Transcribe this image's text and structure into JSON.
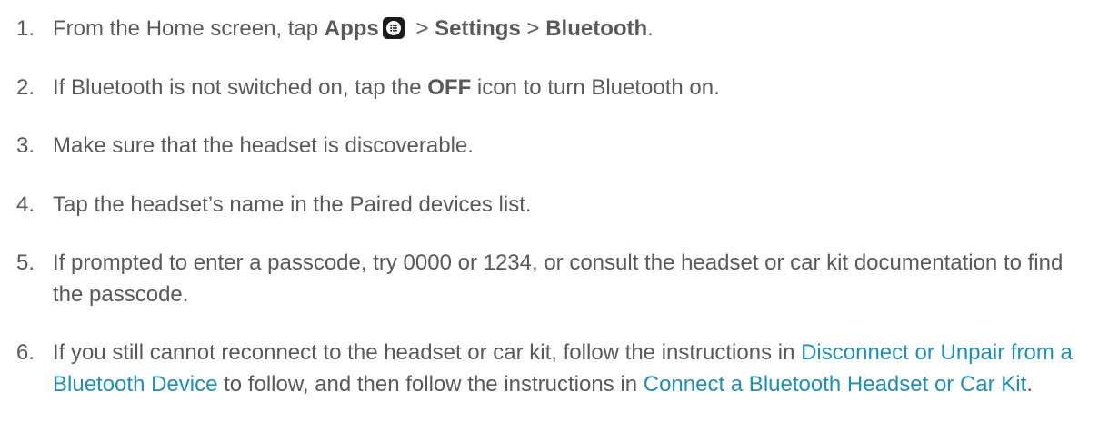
{
  "steps": [
    {
      "num": "1.",
      "pre": "From the Home screen, tap ",
      "apps": "Apps",
      "icon": "apps-grid-icon",
      "sep1": " > ",
      "settings": "Settings",
      "sep2": " > ",
      "bluetooth": "Bluetooth",
      "end": "."
    },
    {
      "num": "2.",
      "pre": "If Bluetooth is not switched on, tap the ",
      "off": "OFF",
      "post": " icon to turn Bluetooth on."
    },
    {
      "num": "3.",
      "text": "Make sure that the headset is discoverable."
    },
    {
      "num": "4.",
      "text": "Tap the headset’s name in the Paired devices list."
    },
    {
      "num": "5.",
      "text": "If prompted to enter a passcode, try 0000 or 1234, or consult the headset or car kit documentation to find the passcode."
    },
    {
      "num": "6.",
      "pre": "If you still cannot reconnect to the headset or car kit, follow the instructions in ",
      "link1": "Disconnect or Unpair from a Bluetooth Device",
      "mid": " to follow, and then follow the instructions in ",
      "link2": "Connect a Bluetooth Headset or Car Kit",
      "end": "."
    }
  ],
  "colors": {
    "text": "#595959",
    "link": "#1a8fbd",
    "icon_bg": "#1a1a1a"
  }
}
